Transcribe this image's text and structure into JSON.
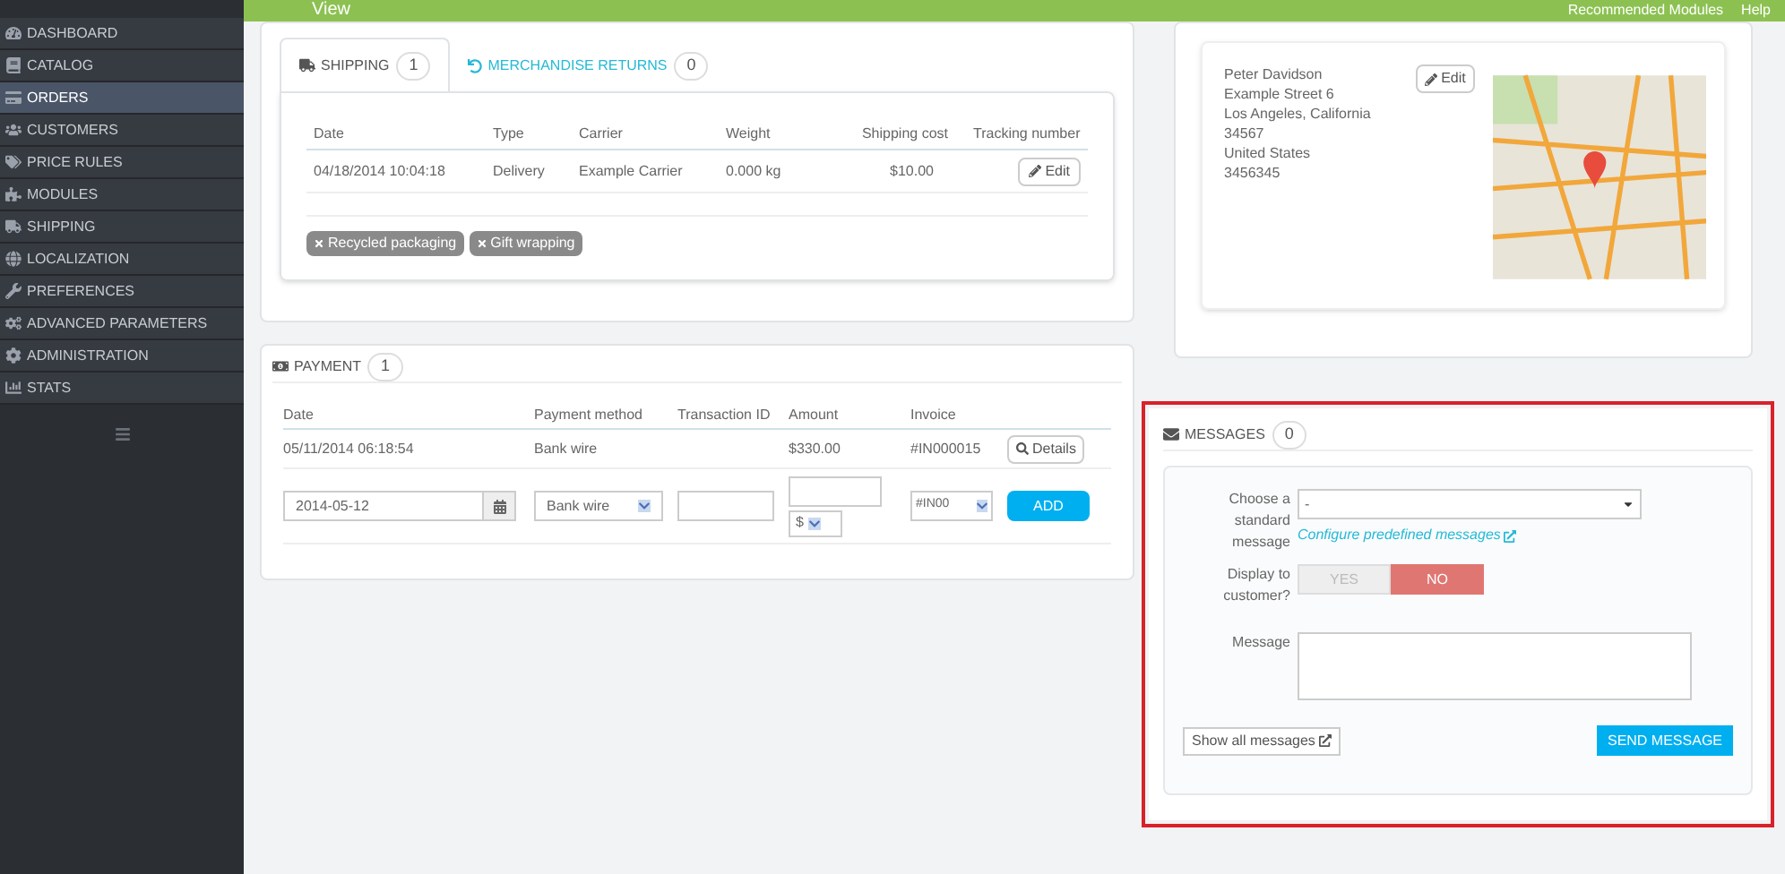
{
  "header": {
    "title": "View",
    "links": [
      "Recommended Modules",
      "Help"
    ]
  },
  "sidebar": {
    "items": [
      {
        "label": "DASHBOARD",
        "selected": false
      },
      {
        "label": "CATALOG",
        "selected": false
      },
      {
        "label": "ORDERS",
        "selected": true
      },
      {
        "label": "CUSTOMERS",
        "selected": false
      },
      {
        "label": "PRICE RULES",
        "selected": false
      },
      {
        "label": "MODULES",
        "selected": false
      },
      {
        "label": "SHIPPING",
        "selected": false
      },
      {
        "label": "LOCALIZATION",
        "selected": false
      },
      {
        "label": "PREFERENCES",
        "selected": false
      },
      {
        "label": "ADVANCED PARAMETERS",
        "selected": false
      },
      {
        "label": "ADMINISTRATION",
        "selected": false
      },
      {
        "label": "STATS",
        "selected": false
      }
    ]
  },
  "shipping": {
    "tabs": [
      {
        "label": "SHIPPING",
        "count": "1",
        "selected": true
      },
      {
        "label": "MERCHANDISE RETURNS",
        "count": "0",
        "selected": false
      }
    ],
    "columns": [
      "Date",
      "Type",
      "Carrier",
      "Weight",
      "Shipping cost",
      "Tracking number"
    ],
    "rows": [
      {
        "cells": [
          "04/18/2014 10:04:18",
          "Delivery",
          "Example Carrier",
          "0.000 kg",
          "$10.00"
        ],
        "action": "Edit"
      }
    ],
    "tags": [
      "Recycled packaging",
      "Gift wrapping"
    ]
  },
  "payment": {
    "title": "PAYMENT",
    "count": "1",
    "columns": [
      "Date",
      "Payment method",
      "Transaction ID",
      "Amount",
      "Invoice"
    ],
    "rows": [
      {
        "date": "05/11/2014 06:18:54",
        "method": "Bank wire",
        "amount": "$330.00",
        "invoice": "#IN000015",
        "action": "Details"
      }
    ],
    "form": {
      "date": "2014-05-12",
      "method": "Bank wire",
      "currency": "$",
      "invoice": "#IN00",
      "button": "ADD"
    }
  },
  "address": {
    "lines": [
      "Peter Davidson",
      "Example Street 6",
      "Los Angeles, California 34567",
      "United States",
      "3456345"
    ],
    "edit": "Edit"
  },
  "messages": {
    "title": "MESSAGES",
    "count": "0",
    "standard_label": "Choose a standard message",
    "standard_value": "-",
    "configure_link": "Configure predefined messages",
    "display_label": "Display to customer?",
    "display_options": [
      {
        "label": "YES",
        "selected": false
      },
      {
        "label": "NO",
        "selected": true
      }
    ],
    "message_label": "Message",
    "show_all": "Show all messages",
    "send": "SEND MESSAGE"
  }
}
